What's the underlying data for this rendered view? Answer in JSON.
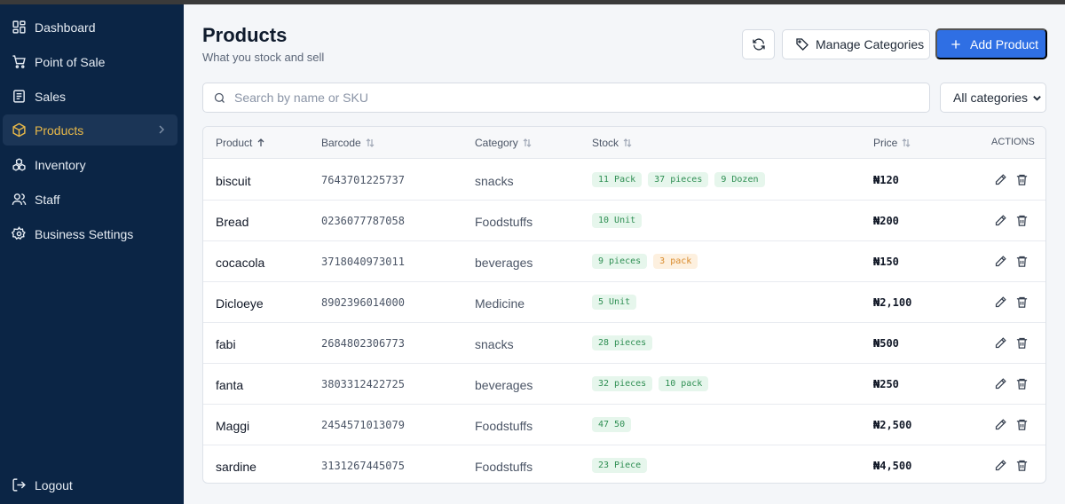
{
  "sidebar": {
    "items": [
      {
        "label": "Dashboard",
        "icon": "grid-icon"
      },
      {
        "label": "Point of Sale",
        "icon": "cart-icon"
      },
      {
        "label": "Sales",
        "icon": "receipt-icon"
      },
      {
        "label": "Products",
        "icon": "box-icon",
        "active": true
      },
      {
        "label": "Inventory",
        "icon": "boxes-icon"
      },
      {
        "label": "Staff",
        "icon": "users-icon"
      },
      {
        "label": "Business Settings",
        "icon": "gear-icon"
      }
    ],
    "logout": {
      "label": "Logout",
      "icon": "logout-icon"
    },
    "active_color": "#e9b949"
  },
  "header": {
    "title": "Products",
    "subtitle": "What you stock and sell",
    "manage_label": "Manage Categories",
    "add_label": "Add Product",
    "accent": "#2f6fe4"
  },
  "search": {
    "placeholder": "Search by name or SKU",
    "value": ""
  },
  "filter": {
    "selected": "All categories"
  },
  "table": {
    "columns": {
      "product": "Product",
      "barcode": "Barcode",
      "category": "Category",
      "stock": "Stock",
      "price": "Price",
      "actions": "ACTIONS"
    },
    "rows": [
      {
        "name": "biscuit",
        "barcode": "7643701225737",
        "category": "snacks",
        "stock": [
          {
            "text": "11 Pack",
            "tone": "green"
          },
          {
            "text": "37 pieces",
            "tone": "green"
          },
          {
            "text": "9 Dozen",
            "tone": "green"
          }
        ],
        "price": "₦120"
      },
      {
        "name": "Bread",
        "barcode": "0236077787058",
        "category": "Foodstuffs",
        "stock": [
          {
            "text": "10 Unit",
            "tone": "green"
          }
        ],
        "price": "₦200"
      },
      {
        "name": "cocacola",
        "barcode": "3718040973011",
        "category": "beverages",
        "stock": [
          {
            "text": "9 pieces",
            "tone": "green"
          },
          {
            "text": "3 pack",
            "tone": "orange"
          }
        ],
        "price": "₦150"
      },
      {
        "name": "Dicloeye",
        "barcode": "8902396014000",
        "category": "Medicine",
        "stock": [
          {
            "text": "5 Unit",
            "tone": "green"
          }
        ],
        "price": "₦2,100"
      },
      {
        "name": "fabi",
        "barcode": "2684802306773",
        "category": "snacks",
        "stock": [
          {
            "text": "28 pieces",
            "tone": "green"
          }
        ],
        "price": "₦500"
      },
      {
        "name": "fanta",
        "barcode": "3803312422725",
        "category": "beverages",
        "stock": [
          {
            "text": "32 pieces",
            "tone": "green"
          },
          {
            "text": "10 pack",
            "tone": "green"
          }
        ],
        "price": "₦250"
      },
      {
        "name": "Maggi",
        "barcode": "2454571013079",
        "category": "Foodstuffs",
        "stock": [
          {
            "text": "47 50",
            "tone": "green"
          }
        ],
        "price": "₦2,500"
      },
      {
        "name": "sardine",
        "barcode": "3131267445075",
        "category": "Foodstuffs",
        "stock": [
          {
            "text": "23 Piece",
            "tone": "green"
          }
        ],
        "price": "₦4,500"
      }
    ]
  }
}
